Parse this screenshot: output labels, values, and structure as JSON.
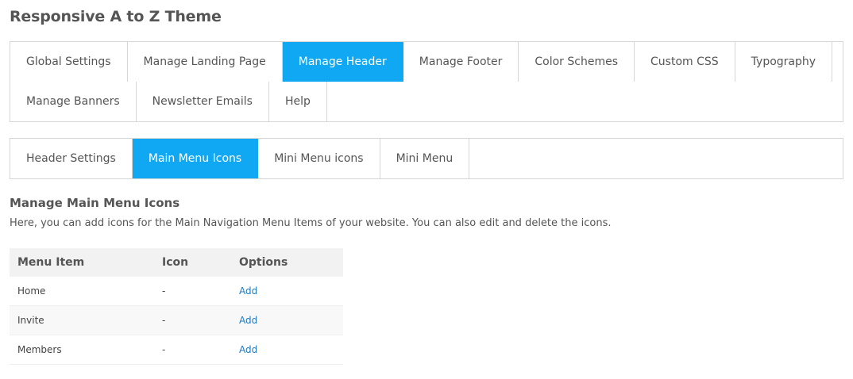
{
  "page": {
    "title": "Responsive A to Z Theme"
  },
  "main_tabs": [
    {
      "label": "Global Settings",
      "active": false
    },
    {
      "label": "Manage Landing Page",
      "active": false
    },
    {
      "label": "Manage Header",
      "active": true
    },
    {
      "label": "Manage Footer",
      "active": false
    },
    {
      "label": "Color Schemes",
      "active": false
    },
    {
      "label": "Custom CSS",
      "active": false
    },
    {
      "label": "Typography",
      "active": false
    },
    {
      "label": "Manage Banners",
      "active": false
    },
    {
      "label": "Newsletter Emails",
      "active": false
    },
    {
      "label": "Help",
      "active": false
    }
  ],
  "sub_tabs": [
    {
      "label": "Header Settings",
      "active": false
    },
    {
      "label": "Main Menu Icons",
      "active": true
    },
    {
      "label": "Mini Menu icons",
      "active": false
    },
    {
      "label": "Mini Menu",
      "active": false
    }
  ],
  "section": {
    "title": "Manage Main Menu Icons",
    "description": "Here, you can add icons for the Main Navigation Menu Items of your website. You can also edit and delete the icons."
  },
  "table": {
    "headers": [
      "Menu Item",
      "Icon",
      "Options"
    ],
    "rows": [
      {
        "item": "Home",
        "icon": "-",
        "option": "Add"
      },
      {
        "item": "Invite",
        "icon": "-",
        "option": "Add"
      },
      {
        "item": "Members",
        "icon": "-",
        "option": "Add"
      }
    ]
  },
  "colors": {
    "active_tab": "#10a8f2",
    "link": "#1e7ac2",
    "border": "#d6d6d6",
    "header_bg": "#f2f2f2"
  }
}
